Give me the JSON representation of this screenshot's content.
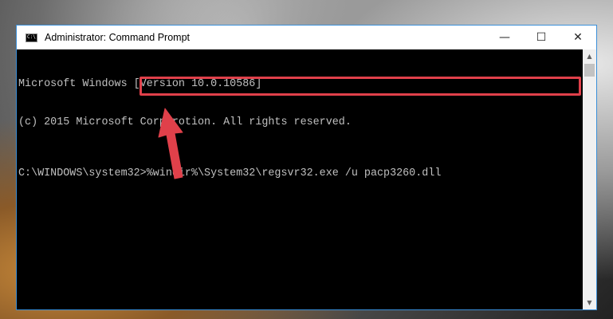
{
  "window": {
    "title": "Administrator: Command Prompt",
    "icon_text": "C:\\",
    "controls": {
      "minimize": "—",
      "maximize": "☐",
      "close": "✕"
    }
  },
  "console": {
    "line1": "Microsoft Windows [Version 10.0.10586]",
    "line2": "(c) 2015 Microsoft Corporotion. All rights reserved.",
    "prompt": "C:\\WINDOWS\\system32>",
    "command": "%windir%\\System32\\regsvr32.exe /u pacp3260.dll"
  },
  "annotation": {
    "highlight_color": "#e0404a",
    "arrow_color": "#e0404a"
  },
  "scrollbar": {
    "up_icon": "▲",
    "down_icon": "▼"
  }
}
